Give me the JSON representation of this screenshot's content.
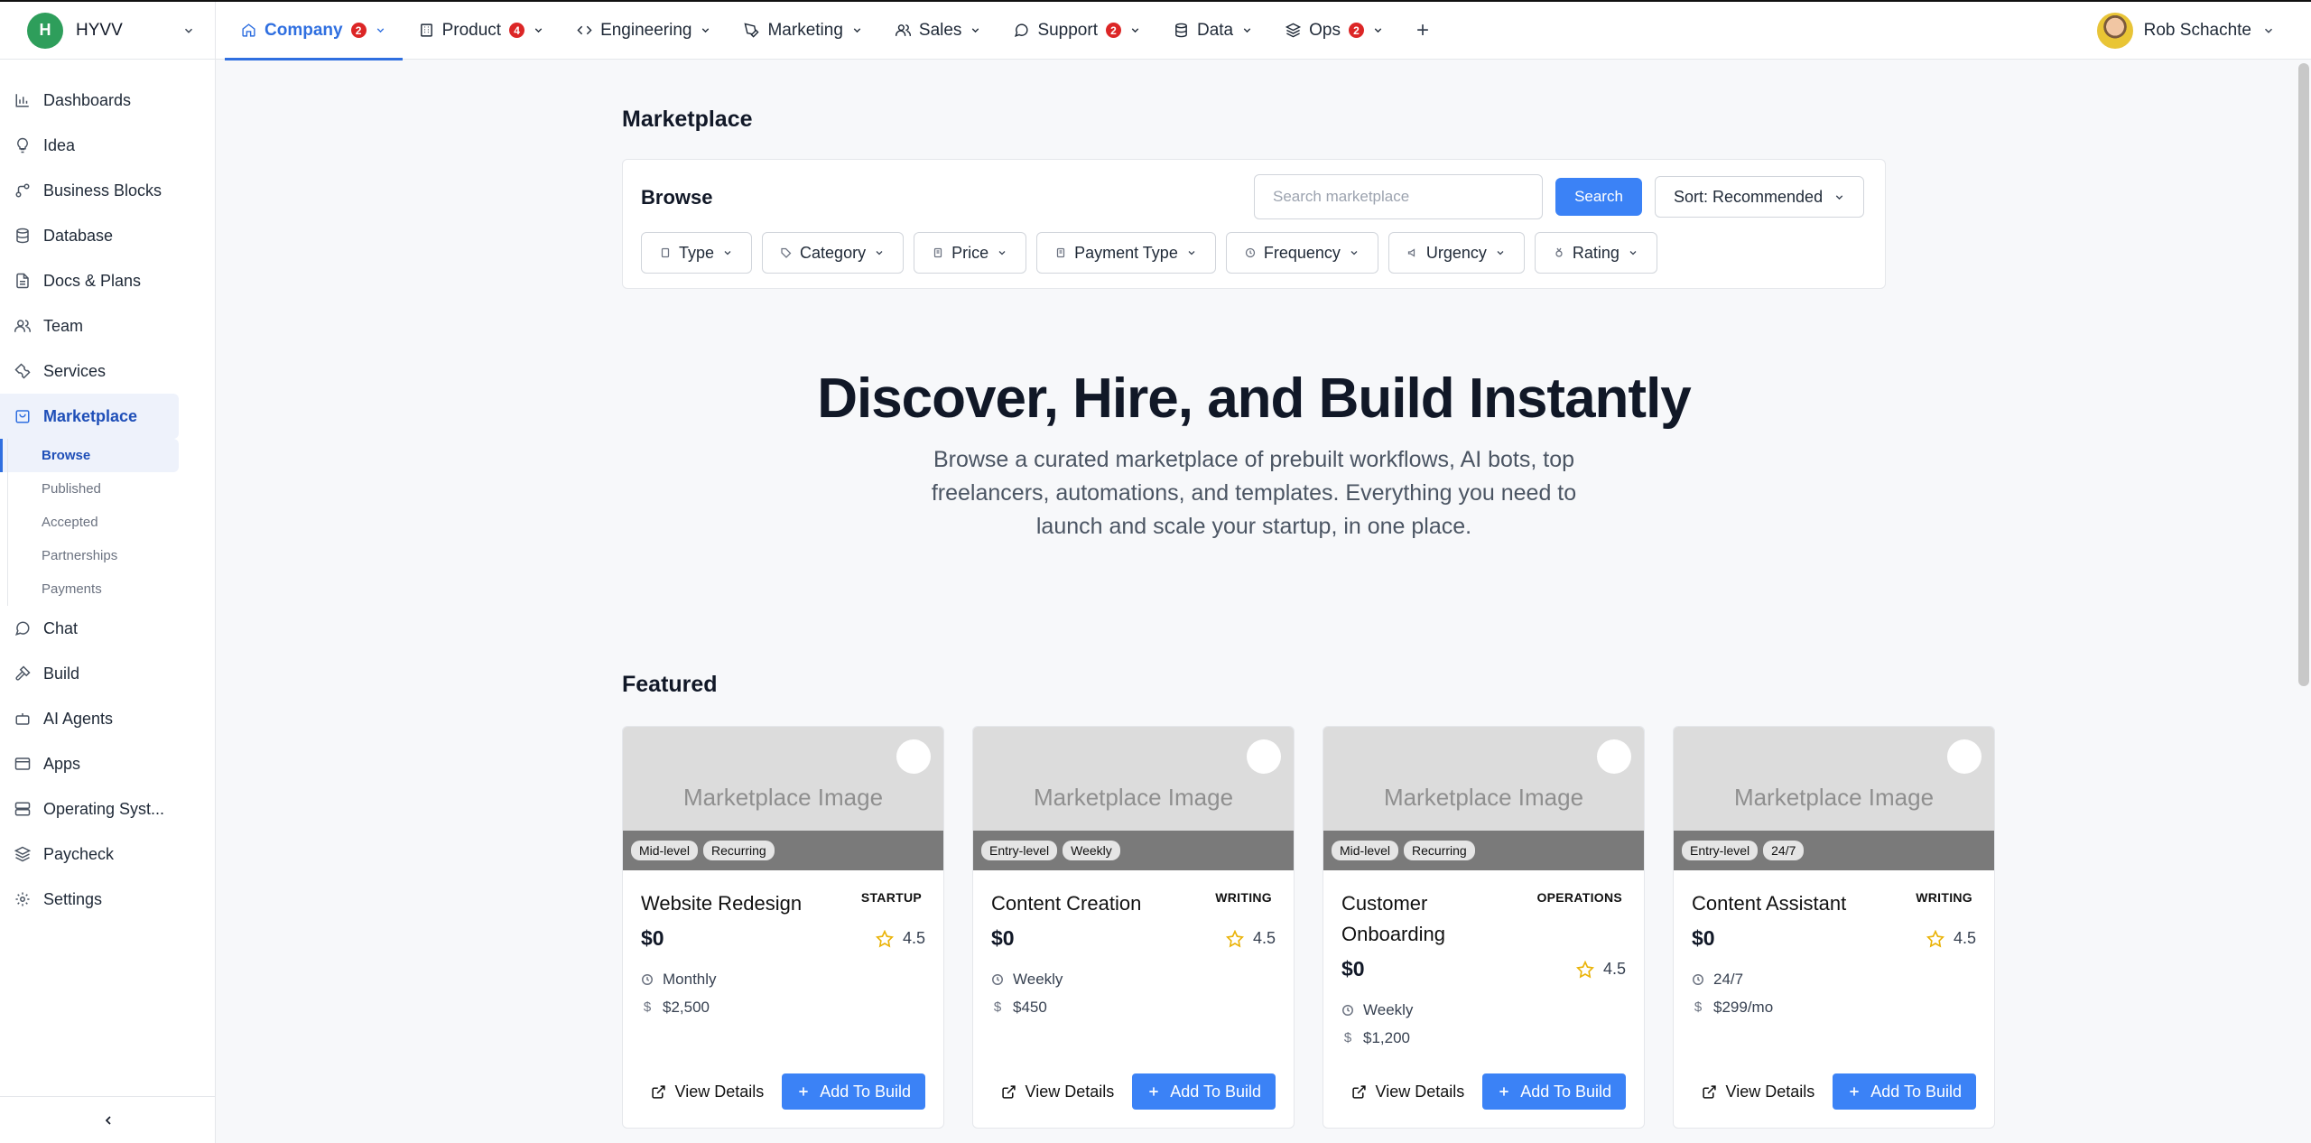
{
  "org": {
    "initial": "H",
    "name": "HYVV"
  },
  "tabs": [
    {
      "label": "Company",
      "badge": "2",
      "icon": "home-icon",
      "active": true
    },
    {
      "label": "Product",
      "badge": "4",
      "icon": "building-icon"
    },
    {
      "label": "Engineering",
      "badge": "",
      "icon": "code-icon"
    },
    {
      "label": "Marketing",
      "badge": "",
      "icon": "pen-tool-icon"
    },
    {
      "label": "Sales",
      "badge": "",
      "icon": "users-icon"
    },
    {
      "label": "Support",
      "badge": "2",
      "icon": "message-circle-icon"
    },
    {
      "label": "Data",
      "badge": "",
      "icon": "database-icon"
    },
    {
      "label": "Ops",
      "badge": "2",
      "icon": "layers-icon"
    }
  ],
  "add_tab": "+",
  "user": {
    "name": "Rob Schachte"
  },
  "sidebar": {
    "items": [
      {
        "label": "Dashboards",
        "icon": "bar-chart-icon"
      },
      {
        "label": "Idea",
        "icon": "lightbulb-icon"
      },
      {
        "label": "Business Blocks",
        "icon": "workflow-icon"
      },
      {
        "label": "Database",
        "icon": "database-icon"
      },
      {
        "label": "Docs & Plans",
        "icon": "file-text-icon"
      },
      {
        "label": "Team",
        "icon": "users-icon"
      },
      {
        "label": "Services",
        "icon": "wrench-icon"
      },
      {
        "label": "Marketplace",
        "icon": "shopping-bag-icon",
        "active": true
      }
    ],
    "sub_items": [
      {
        "label": "Browse",
        "active": true
      },
      {
        "label": "Published"
      },
      {
        "label": "Accepted"
      },
      {
        "label": "Partnerships"
      },
      {
        "label": "Payments"
      }
    ],
    "items_after": [
      {
        "label": "Chat",
        "icon": "message-circle-icon"
      },
      {
        "label": "Build",
        "icon": "hammer-icon"
      },
      {
        "label": "AI Agents",
        "icon": "bot-icon"
      },
      {
        "label": "Apps",
        "icon": "app-window-icon"
      },
      {
        "label": "Operating Syst...",
        "icon": "server-icon"
      },
      {
        "label": "Paycheck",
        "icon": "layers-icon"
      },
      {
        "label": "Settings",
        "icon": "gear-icon"
      }
    ]
  },
  "page": {
    "title": "Marketplace"
  },
  "browse": {
    "title": "Browse",
    "search_placeholder": "Search marketplace",
    "search_value": "",
    "search_label": "Search",
    "sort_label": "Sort: Recommended",
    "filters": [
      "Type",
      "Category",
      "Price",
      "Payment Type",
      "Frequency",
      "Urgency",
      "Rating"
    ]
  },
  "hero": {
    "title": "Discover, Hire, and Build Instantly",
    "subtitle": "Browse a curated marketplace of prebuilt workflows, AI bots, top freelancers, automations, and templates. Everything you need to launch and scale your startup, in one place."
  },
  "featured": {
    "title": "Featured",
    "image_label": "Marketplace Image",
    "view_label": "View Details",
    "add_label": "Add To Build",
    "cards": [
      {
        "tags": [
          "Mid-level",
          "Recurring"
        ],
        "name": "Website Redesign",
        "category": "STARTUP",
        "price": "$0",
        "rating": "4.5",
        "frequency": "Monthly",
        "budget": "$2,500"
      },
      {
        "tags": [
          "Entry-level",
          "Weekly"
        ],
        "name": "Content Creation",
        "category": "WRITING",
        "price": "$0",
        "rating": "4.5",
        "frequency": "Weekly",
        "budget": "$450"
      },
      {
        "tags": [
          "Mid-level",
          "Recurring"
        ],
        "name": "Customer Onboarding",
        "category": "OPERATIONS",
        "price": "$0",
        "rating": "4.5",
        "frequency": "Weekly",
        "budget": "$1,200"
      },
      {
        "tags": [
          "Entry-level",
          "24/7"
        ],
        "name": "Content Assistant",
        "category": "WRITING",
        "price": "$0",
        "rating": "4.5",
        "frequency": "24/7",
        "budget": "$299/mo"
      }
    ]
  },
  "colors": {
    "accent": "#3b82f6",
    "badge": "#dc2626",
    "org_avatar": "#2e9e5b"
  }
}
